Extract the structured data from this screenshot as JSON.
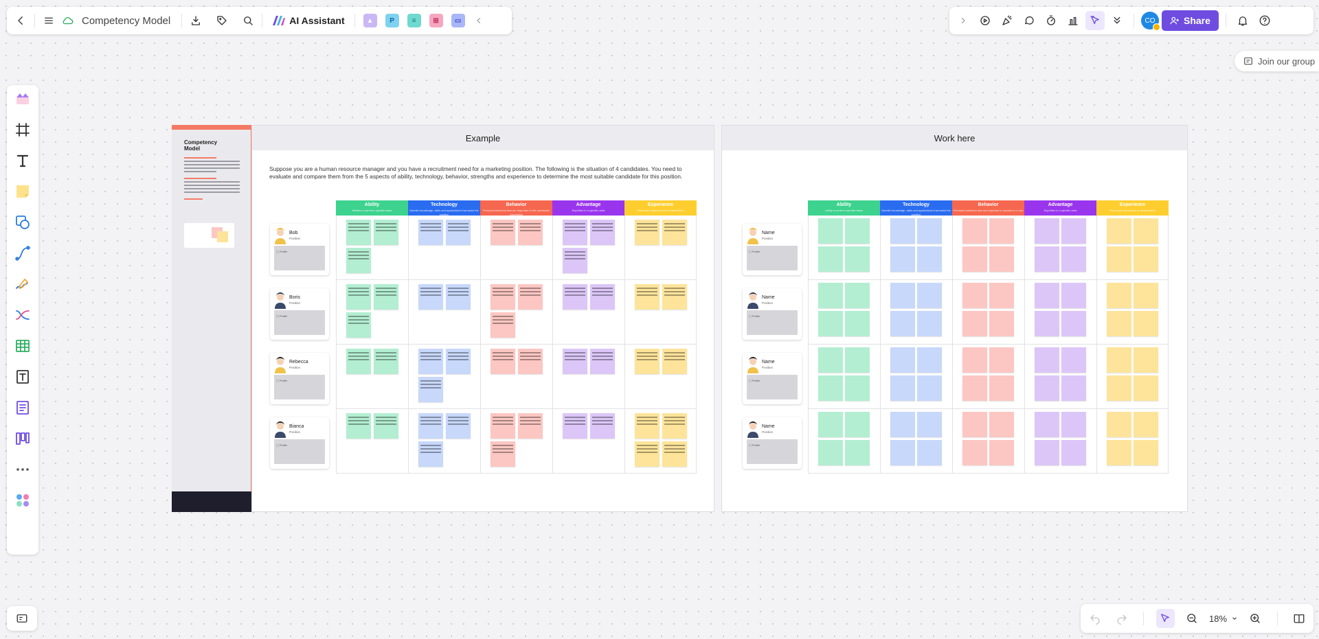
{
  "toolbar": {
    "title": "Competency Model",
    "ai_label": "AI Assistant",
    "plugins": [
      "image-plugin",
      "p-plugin",
      "flow-plugin",
      "mindmap-plugin",
      "chat-plugin"
    ]
  },
  "right": {
    "avatar": "CO",
    "share": "Share"
  },
  "join": "Join our group",
  "zoom": "18%",
  "colors": {
    "accent": "#6e4ce0",
    "ability": "#3dd28e",
    "technology": "#2a6cf0",
    "behavior": "#f6674f",
    "advantage": "#9a35ee",
    "experience": "#ffce2e",
    "note_ability": "#b3eed2",
    "note_technology": "#c7d8fb",
    "note_behavior": "#fcc7c2",
    "note_advantage": "#dcc6f7",
    "note_experience": "#fde49a"
  },
  "board": {
    "left_strip": {
      "title": "Competency Model"
    },
    "example": {
      "header": "Example",
      "description": "Suppose you are a human resource manager and you have a recruitment need for a marketing position. The following is the situation of 4 candidates. You need to evaluate and compare them from the 5 aspects of ability, technology, behavior, strengths and experience to determine the most suitable candidate for this position.",
      "columns": [
        {
          "name": "Ability",
          "sub": "Abilities to perform specific tasks"
        },
        {
          "name": "Technology",
          "sub": "Specific knowledge, skills and applications that assist the position"
        },
        {
          "name": "Behavior",
          "sub": "Personal behaviors that are important to the successful completion"
        },
        {
          "name": "Advantage",
          "sub": "Expertise in a specific area"
        },
        {
          "name": "Experience",
          "sub": "Past work experience in a related field"
        }
      ],
      "candidates": [
        {
          "name": "Bob",
          "position": "Position",
          "profile": "Profile"
        },
        {
          "name": "Boris",
          "position": "Position",
          "profile": "Profile"
        },
        {
          "name": "Rebecca",
          "position": "Position",
          "profile": "Profile"
        },
        {
          "name": "Bianca",
          "position": "Position",
          "profile": "Profile"
        }
      ]
    },
    "work": {
      "header": "Work here",
      "columns": [
        {
          "name": "Ability",
          "sub": "Ability to perform specific tasks"
        },
        {
          "name": "Technology",
          "sub": "Specific knowledge, skills and applications that assist the position"
        },
        {
          "name": "Behavior",
          "sub": "Personal behaviors that are important to success in a role"
        },
        {
          "name": "Advantage",
          "sub": "Expertise in a specific area"
        },
        {
          "name": "Experience",
          "sub": "Past work experience in related fields"
        }
      ],
      "candidates": [
        {
          "name": "Name",
          "position": "Position",
          "profile": "Profile"
        },
        {
          "name": "Name",
          "position": "Position",
          "profile": "Profile"
        },
        {
          "name": "Name",
          "position": "Position",
          "profile": "Profile"
        },
        {
          "name": "Name",
          "position": "Position",
          "profile": "Profile"
        }
      ]
    }
  }
}
